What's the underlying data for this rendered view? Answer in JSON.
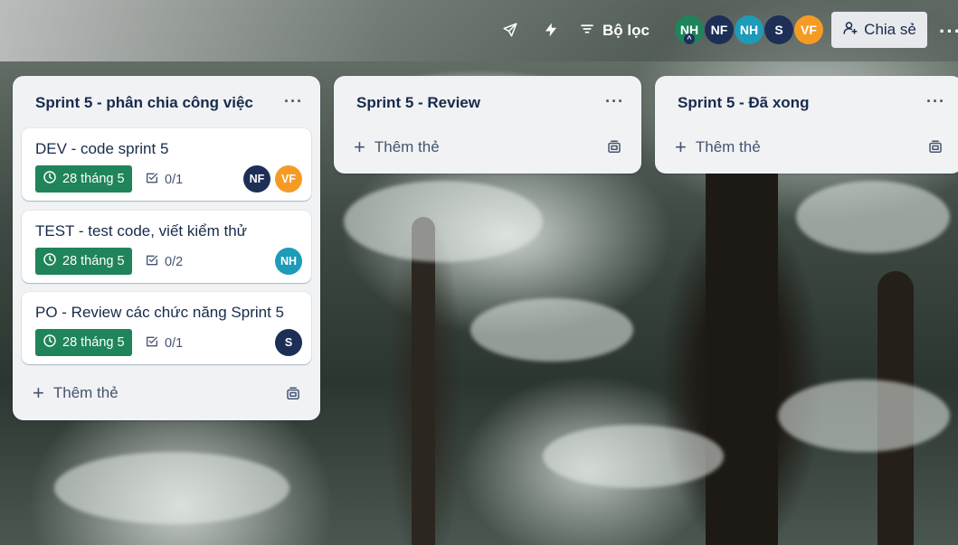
{
  "topbar": {
    "filter_label": "Bộ lọc",
    "share_label": "Chia sẻ",
    "members": [
      {
        "initials": "NH",
        "color": "#1f845a"
      },
      {
        "initials": "NF",
        "color": "#1d2f57"
      },
      {
        "initials": "NH",
        "color": "#1d9bb8"
      },
      {
        "initials": "S",
        "color": "#1d2f57"
      },
      {
        "initials": "VF",
        "color": "#f59b24"
      }
    ]
  },
  "lists": [
    {
      "title": "Sprint 5 - phân chia công việc",
      "add_card_label": "Thêm thẻ",
      "cards": [
        {
          "title": "DEV - code sprint 5",
          "due": "28 tháng 5",
          "checklist": "0/1",
          "members": [
            "NF",
            "VF"
          ]
        },
        {
          "title": "TEST - test code, viết kiểm thử",
          "due": "28 tháng 5",
          "checklist": "0/2",
          "members": [
            "NH"
          ]
        },
        {
          "title": "PO - Review các chức năng Sprint 5",
          "due": "28 tháng 5",
          "checklist": "0/1",
          "members": [
            "S"
          ]
        }
      ]
    },
    {
      "title": "Sprint 5 - Review",
      "add_card_label": "Thêm thẻ",
      "cards": []
    },
    {
      "title": "Sprint 5 - Đã xong",
      "add_card_label": "Thêm thẻ",
      "cards": []
    }
  ],
  "colors": {
    "due_badge": "#1f845a",
    "avatar_navy": "#1d2f57",
    "avatar_teal": "#1d9bb8",
    "avatar_orange": "#f59b24"
  }
}
